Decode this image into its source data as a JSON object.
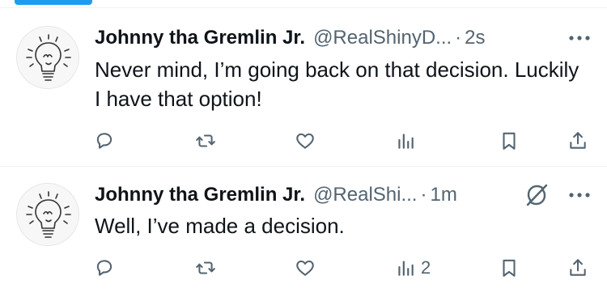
{
  "tweets": [
    {
      "name": "Johnny tha Gremlin Jr.",
      "handle": "@RealShinyD...",
      "separator": "·",
      "time": "2s",
      "text": "Never mind, I’m going back on that decision. Luckily I have that option!",
      "views": "",
      "icons": [
        "lightbulb-avatar",
        "more-icon",
        "reply-icon",
        "repost-icon",
        "like-icon",
        "views-icon",
        "bookmark-icon",
        "share-icon"
      ]
    },
    {
      "name": "Johnny tha Gremlin Jr.",
      "handle": "@RealShi...",
      "separator": "·",
      "time": "1m",
      "text": "Well, I’ve made a decision.",
      "views": "2",
      "icons": [
        "lightbulb-avatar",
        "grok-icon",
        "more-icon",
        "reply-icon",
        "repost-icon",
        "like-icon",
        "views-icon",
        "bookmark-icon",
        "share-icon"
      ]
    }
  ],
  "colors": {
    "accent": "#1d9bf0",
    "text": "#0f1419",
    "secondary": "#536471",
    "border": "#eff3f4"
  }
}
